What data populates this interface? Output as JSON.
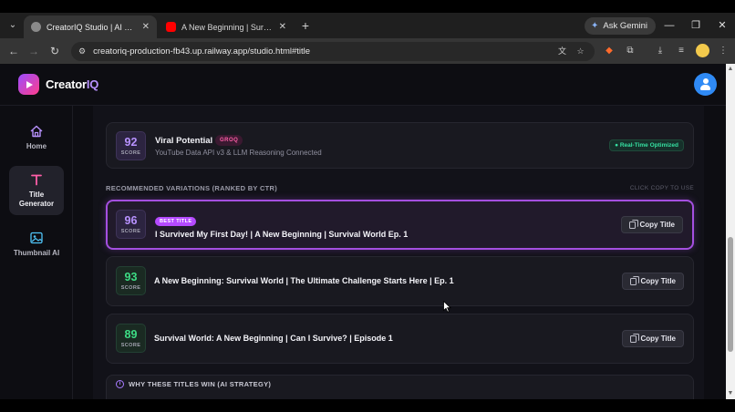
{
  "browser": {
    "tabs": [
      {
        "label": "CreatorIQ Studio | AI Title Intelli",
        "active": true
      },
      {
        "label": "A New Beginning | Survival Wo",
        "active": false
      }
    ],
    "gemini_label": "Ask Gemini",
    "url": "creatoriq-production-fb43.up.railway.app/studio.html#title"
  },
  "app": {
    "brand_prefix": "Creator",
    "brand_suffix": "IQ",
    "colors": {
      "accent": "#b892ff",
      "best_border": "#a44fe0",
      "score_green": "#3ddc84",
      "avatar": "#2f8af5"
    }
  },
  "sidebar": {
    "items": [
      {
        "label_line1": "Home",
        "label_line2": "",
        "icon": "home-icon",
        "active": false
      },
      {
        "label_line1": "Title",
        "label_line2": "Generator",
        "icon": "text-t-icon",
        "active": true
      },
      {
        "label_line1": "Thumbnail AI",
        "label_line2": "",
        "icon": "image-icon",
        "active": false
      }
    ]
  },
  "potential": {
    "score": "92",
    "score_label": "SCORE",
    "title": "Viral Potential",
    "badge": "GROQ",
    "subtitle": "YouTube Data API v3 & LLM Reasoning Connected",
    "status": "● Real-Time Optimized"
  },
  "variations": {
    "heading": "RECOMMENDED VARIATIONS (RANKED BY CTR)",
    "hint": "CLICK COPY TO USE",
    "copy_label": "Copy Title",
    "items": [
      {
        "score": "96",
        "score_label": "SCORE",
        "badge": "BEST TITLE",
        "title": "I Survived My First Day! | A New Beginning | Survival World Ep. 1"
      },
      {
        "score": "93",
        "score_label": "SCORE",
        "badge": "",
        "title": "A New Beginning: Survival World | The Ultimate Challenge Starts Here | Ep. 1"
      },
      {
        "score": "89",
        "score_label": "SCORE",
        "badge": "",
        "title": "Survival World: A New Beginning | Can I Survive? | Episode 1"
      }
    ]
  },
  "why": {
    "heading": "WHY THESE TITLES WIN (AI STRATEGY)"
  }
}
